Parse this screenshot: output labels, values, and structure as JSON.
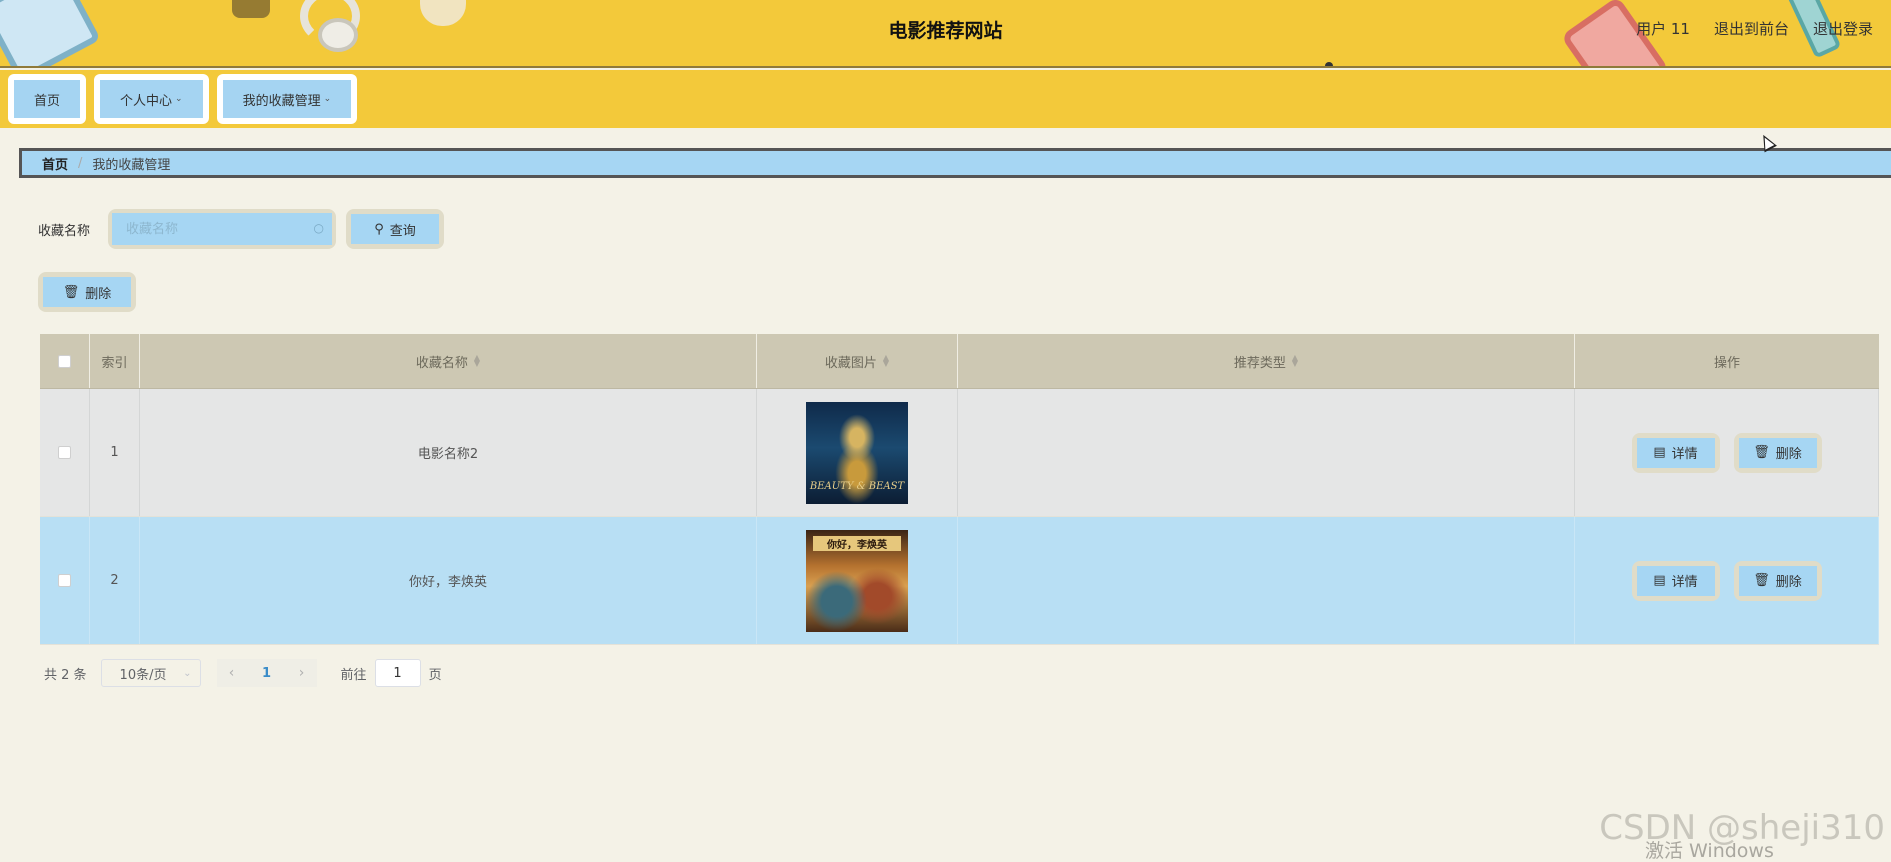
{
  "header": {
    "site_title": "电影推荐网站",
    "user": "用户 11",
    "exit_front": "退出到前台",
    "logout": "退出登录"
  },
  "nav": {
    "home": "首页",
    "personal_center": "个人中心",
    "my_favorites": "我的收藏管理"
  },
  "breadcrumb": {
    "home": "首页",
    "separator": "/",
    "current": "我的收藏管理"
  },
  "search": {
    "label": "收藏名称",
    "placeholder": "收藏名称",
    "query_button": "查询"
  },
  "toolbar": {
    "delete_button": "删除"
  },
  "table": {
    "headers": {
      "index": "索引",
      "name": "收藏名称",
      "picture": "收藏图片",
      "type": "推荐类型",
      "operation": "操作"
    },
    "rows": [
      {
        "index": "1",
        "name": "电影名称2",
        "poster_text": "BEAUTY & BEAST",
        "type": "",
        "detail": "详情",
        "delete": "删除"
      },
      {
        "index": "2",
        "name": "你好，李焕英",
        "poster_text": "你好，李焕英",
        "type": "",
        "detail": "详情",
        "delete": "删除"
      }
    ]
  },
  "pagination": {
    "total": "共 2 条",
    "page_size": "10条/页",
    "current_page": "1",
    "goto_label": "前往",
    "goto_value": "1",
    "page_unit": "页"
  },
  "overlay": {
    "watermark": "CSDN @sheji310",
    "windows_activation": "激活 Windows"
  },
  "colors": {
    "header_bg": "#f3c93a",
    "button_bg": "#a6d6f3",
    "table_header_bg": "#cdc8b3",
    "row_highlight": "#b8dff4",
    "page_bg": "#f4f2e7"
  }
}
